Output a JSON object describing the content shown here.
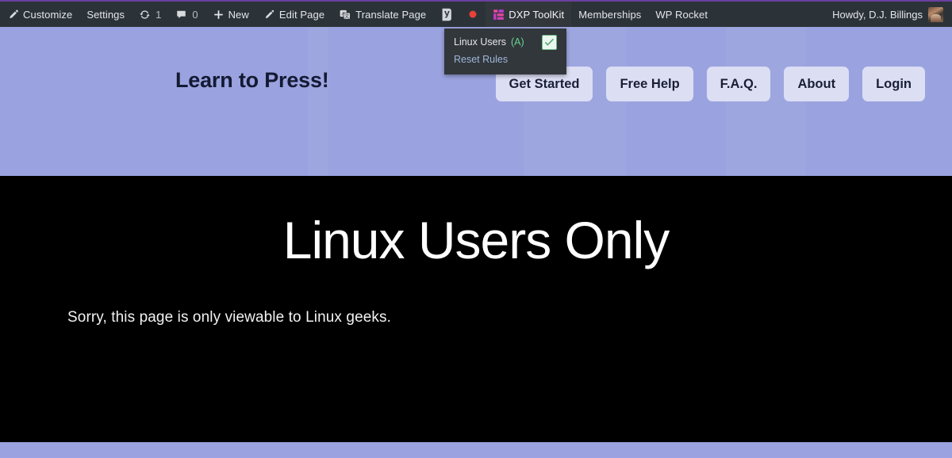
{
  "admin_bar": {
    "left_items": [
      {
        "id": "customize",
        "label": "Customize",
        "icon": "paintbrush-icon"
      },
      {
        "id": "settings",
        "label": "Settings",
        "icon": null
      },
      {
        "id": "updates",
        "label": "1",
        "icon": "updates-icon"
      },
      {
        "id": "comments",
        "label": "0",
        "icon": "comment-bubble-icon"
      },
      {
        "id": "new",
        "label": "New",
        "icon": "plus-icon"
      },
      {
        "id": "edit-page",
        "label": "Edit Page",
        "icon": "pencil-icon"
      },
      {
        "id": "translate-page",
        "label": "Translate Page",
        "icon": "translate-icon"
      },
      {
        "id": "yoast",
        "label": "",
        "icon": "yoast-icon"
      },
      {
        "id": "recording",
        "label": "",
        "icon": "record-dot-icon"
      },
      {
        "id": "dxp-toolkit",
        "label": "DXP ToolKit",
        "icon": "dxp-grid-icon",
        "active": true
      },
      {
        "id": "memberships",
        "label": "Memberships",
        "icon": null
      },
      {
        "id": "wp-rocket",
        "label": "WP Rocket",
        "icon": null
      }
    ],
    "dxp_submenu": {
      "items": [
        {
          "id": "linux-users",
          "label": "Linux Users",
          "suffix": "(A)",
          "checked": true
        },
        {
          "id": "reset-rules",
          "label": "Reset Rules",
          "suffix": "",
          "checked": false
        }
      ]
    },
    "account": {
      "greeting": "Howdy, D.J. Billings"
    }
  },
  "site_header": {
    "title": "Learn to Press!",
    "nav": [
      {
        "id": "get-started",
        "label": "Get Started"
      },
      {
        "id": "free-help",
        "label": "Free Help"
      },
      {
        "id": "faq",
        "label": "F.A.Q."
      },
      {
        "id": "about",
        "label": "About"
      },
      {
        "id": "login",
        "label": "Login"
      }
    ]
  },
  "main": {
    "heading": "Linux Users Only",
    "body": "Sorry, this page is only viewable to Linux geeks."
  },
  "colors": {
    "admin_bar_bg": "#2c3338",
    "admin_bar_top_rule": "#6b3fa0",
    "header_lavender": "#9aa3df",
    "nav_button_bg": "#dcdef4",
    "title_navy": "#141a33",
    "main_bg": "#000000",
    "submenu_bg": "#32373c",
    "submenu_link_blue": "#9fb6d8",
    "submenu_accent_green": "#68d391",
    "dxp_icon_pink": "#e0499a",
    "record_dot_red": "#e8413a"
  }
}
